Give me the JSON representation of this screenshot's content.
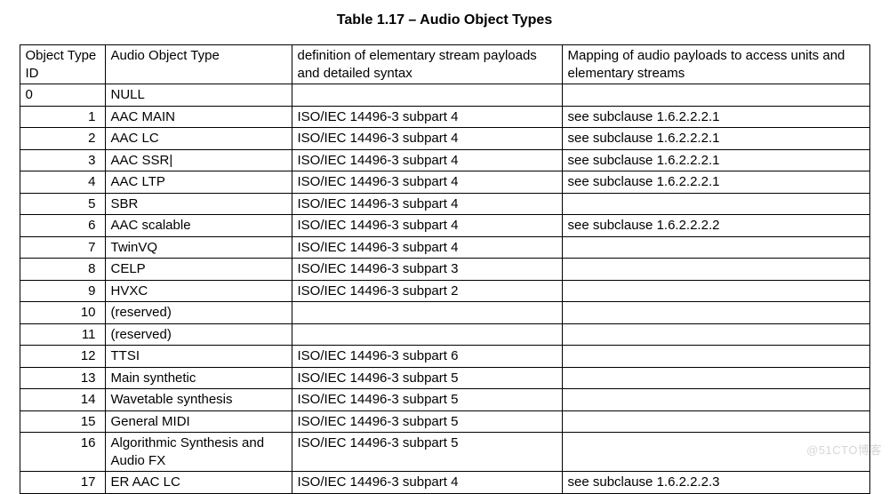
{
  "title": "Table 1.17 – Audio Object Types",
  "headers": {
    "id": "Object Type ID",
    "type": "Audio Object Type",
    "def": "definition of elementary stream payloads and detailed syntax",
    "map": "Mapping of audio payloads to access units and elementary streams"
  },
  "rows": [
    {
      "id": "0",
      "id_align": "left",
      "type": "NULL",
      "def": "",
      "map": ""
    },
    {
      "id": "1",
      "id_align": "right",
      "type": "AAC MAIN",
      "def": "ISO/IEC 14496-3 subpart 4",
      "map": "see subclause 1.6.2.2.2.1"
    },
    {
      "id": "2",
      "id_align": "right",
      "type": "AAC LC",
      "def": "ISO/IEC 14496-3 subpart 4",
      "map": "see subclause 1.6.2.2.2.1"
    },
    {
      "id": "3",
      "id_align": "right",
      "type": "AAC SSR|",
      "def": "ISO/IEC 14496-3 subpart 4",
      "map": "see subclause 1.6.2.2.2.1"
    },
    {
      "id": "4",
      "id_align": "right",
      "type": "AAC LTP",
      "def": "ISO/IEC 14496-3 subpart 4",
      "map": "see subclause 1.6.2.2.2.1"
    },
    {
      "id": "5",
      "id_align": "right",
      "type": "SBR",
      "def": "ISO/IEC 14496-3 subpart 4",
      "map": ""
    },
    {
      "id": "6",
      "id_align": "right",
      "type": "AAC scalable",
      "def": "ISO/IEC 14496-3 subpart 4",
      "map": "see subclause 1.6.2.2.2.2"
    },
    {
      "id": "7",
      "id_align": "right",
      "type": "TwinVQ",
      "def": "ISO/IEC 14496-3 subpart 4",
      "map": ""
    },
    {
      "id": "8",
      "id_align": "right",
      "type": "CELP",
      "def": "ISO/IEC 14496-3 subpart 3",
      "map": ""
    },
    {
      "id": "9",
      "id_align": "right",
      "type": "HVXC",
      "def": "ISO/IEC 14496-3 subpart 2",
      "map": ""
    },
    {
      "id": "10",
      "id_align": "right",
      "type": "(reserved)",
      "def": "",
      "map": ""
    },
    {
      "id": "11",
      "id_align": "right",
      "type": "(reserved)",
      "def": "",
      "map": ""
    },
    {
      "id": "12",
      "id_align": "right",
      "type": "TTSI",
      "def": "ISO/IEC 14496-3 subpart 6",
      "map": ""
    },
    {
      "id": "13",
      "id_align": "right",
      "type": "Main synthetic",
      "def": "ISO/IEC 14496-3 subpart 5",
      "map": ""
    },
    {
      "id": "14",
      "id_align": "right",
      "type": "Wavetable synthesis",
      "def": "ISO/IEC 14496-3 subpart 5",
      "map": ""
    },
    {
      "id": "15",
      "id_align": "right",
      "type": "General MIDI",
      "def": "ISO/IEC 14496-3 subpart 5",
      "map": ""
    },
    {
      "id": "16",
      "id_align": "right",
      "type": "Algorithmic Synthesis and Audio FX",
      "def": "ISO/IEC 14496-3 subpart 5",
      "map": ""
    },
    {
      "id": "17",
      "id_align": "right",
      "type": "ER AAC LC",
      "def": "ISO/IEC 14496-3 subpart 4",
      "map": "see subclause 1.6.2.2.2.3"
    }
  ],
  "watermark": "@51CTO博客"
}
